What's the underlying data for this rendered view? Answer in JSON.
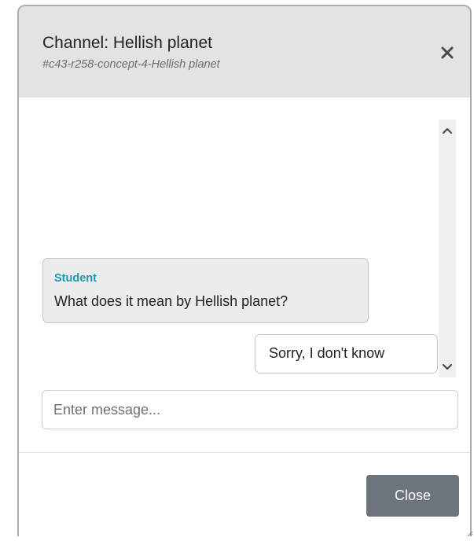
{
  "dialog": {
    "title": "Channel: Hellish planet",
    "subtitle": "#c43-r258-concept-4-Hellish planet",
    "close_icon": "close-icon"
  },
  "messages": [
    {
      "sender": "Student",
      "text": "What does it mean by Hellish planet?",
      "direction": "incoming"
    },
    {
      "text": "Sorry, I don't know",
      "direction": "outgoing"
    }
  ],
  "composer": {
    "placeholder": "Enter message...",
    "value": ""
  },
  "footer": {
    "close_label": "Close"
  },
  "colors": {
    "header_bg": "#e3e3e3",
    "sender_accent": "#1a98b2",
    "close_button_bg": "#6c757d",
    "incoming_bubble_bg": "#ececec"
  }
}
